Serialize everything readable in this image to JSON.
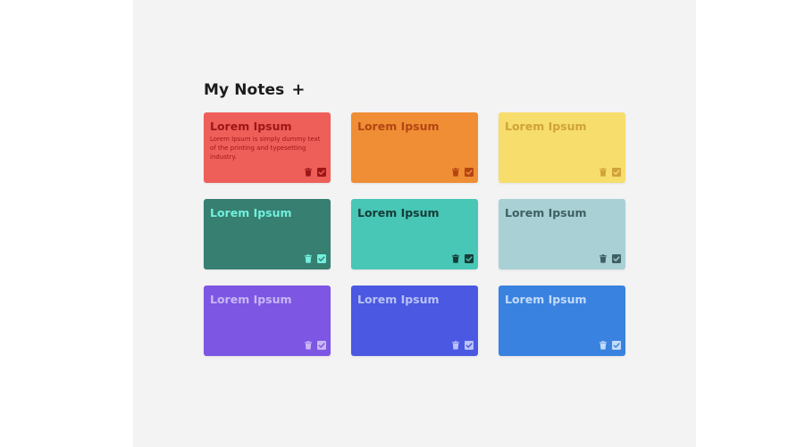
{
  "header": {
    "title": "My Notes",
    "add_label": "+"
  },
  "notes": [
    {
      "title": "Lorem Ipsum",
      "body": "Lorem Ipsum is simply dummy text of the printing and typesetting industry.",
      "bg": "#ee5f5a",
      "fg": "#9e1515"
    },
    {
      "title": "Lorem Ipsum",
      "body": "",
      "bg": "#ef8e35",
      "fg": "#b44513"
    },
    {
      "title": "Lorem Ipsum",
      "body": "",
      "bg": "#f7dd6c",
      "fg": "#d0a23a"
    },
    {
      "title": "Lorem Ipsum",
      "body": "",
      "bg": "#367f71",
      "fg": "#73f0dd"
    },
    {
      "title": "Lorem Ipsum",
      "body": "",
      "bg": "#48c6b6",
      "fg": "#163c38"
    },
    {
      "title": "Lorem Ipsum",
      "body": "",
      "bg": "#a8d0d5",
      "fg": "#3f6063"
    },
    {
      "title": "Lorem Ipsum",
      "body": "",
      "bg": "#7d56e4",
      "fg": "#c9b7f3"
    },
    {
      "title": "Lorem Ipsum",
      "body": "",
      "bg": "#4a58e2",
      "fg": "#b9c2f6"
    },
    {
      "title": "Lorem Ipsum",
      "body": "",
      "bg": "#3a82df",
      "fg": "#c3dbf8"
    }
  ],
  "icons": {
    "delete": "trash-icon",
    "done": "checkbox-icon"
  }
}
